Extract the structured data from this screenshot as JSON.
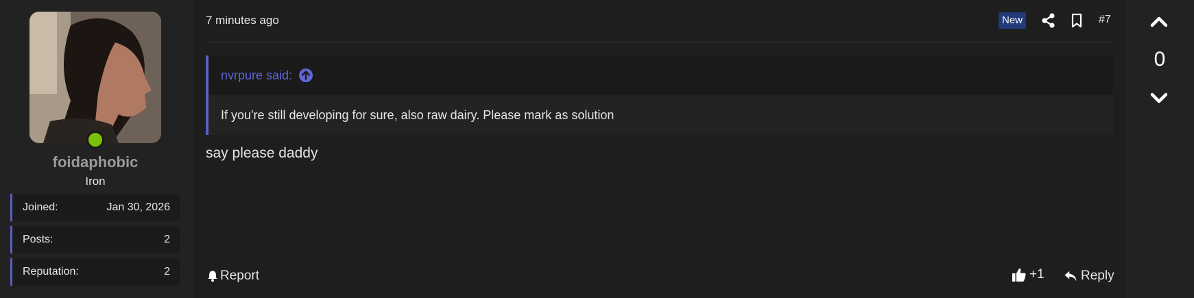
{
  "user": {
    "username": "foidaphobic",
    "rank": "Iron",
    "online": true,
    "stats": [
      {
        "label": "Joined:",
        "value": "Jan 30, 2026"
      },
      {
        "label": "Posts:",
        "value": "2"
      },
      {
        "label": "Reputation:",
        "value": "2"
      }
    ]
  },
  "post": {
    "timestamp": "7 minutes ago",
    "badge": "New",
    "number": "#7",
    "quote": {
      "author_said": "nvrpure said:",
      "text": "If you're still developing for sure, also raw dairy. Please mark as solution"
    },
    "message": "say please daddy",
    "actions": {
      "report": "Report",
      "like": "+1",
      "reply": "Reply"
    }
  },
  "vote": {
    "count": "0"
  },
  "colors": {
    "accent": "#5b5fc7",
    "quote_link": "#5f66d6",
    "online": "#7ac10b",
    "badge_bg": "#22397a"
  }
}
